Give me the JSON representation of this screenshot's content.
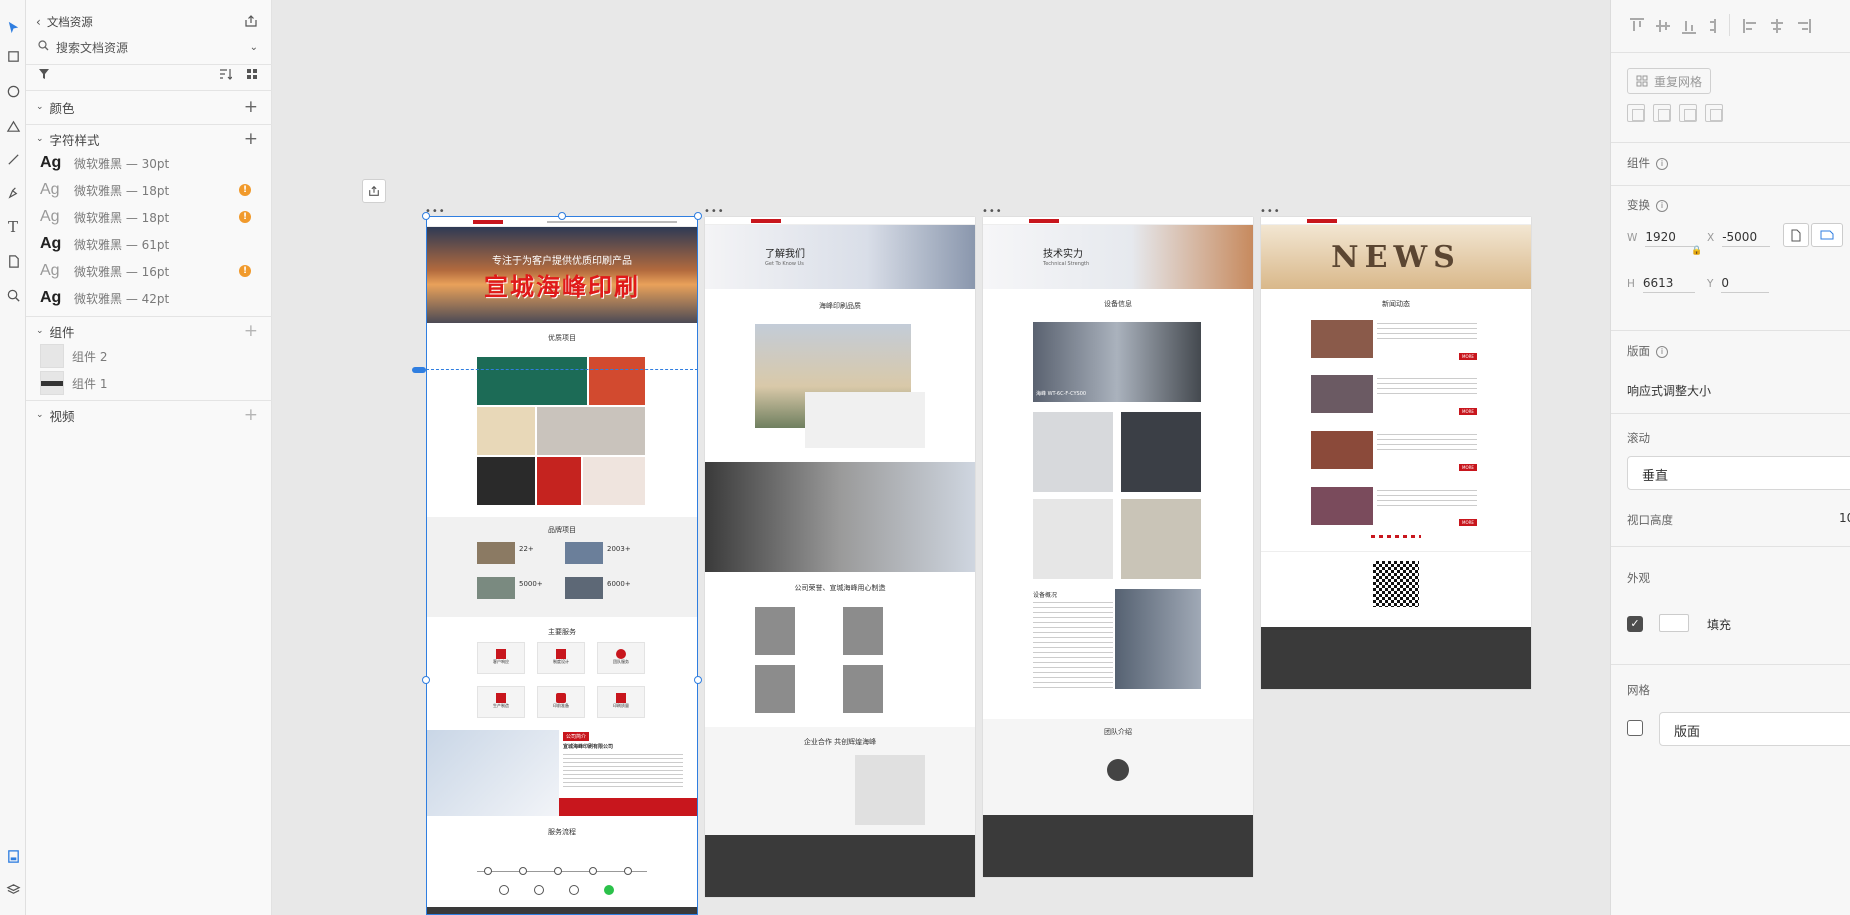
{
  "assets_panel": {
    "back_label": "文档资源",
    "search_placeholder": "搜索文档资源",
    "sections": {
      "colors": "颜色",
      "char_styles": "字符样式",
      "components": "组件",
      "video": "视频"
    },
    "char_styles": [
      {
        "sample": "Ag",
        "name": "微软雅黑 — 30pt",
        "weight": "bold",
        "warning": false
      },
      {
        "sample": "Ag",
        "name": "微软雅黑 — 18pt",
        "weight": "light",
        "warning": true
      },
      {
        "sample": "Ag",
        "name": "微软雅黑 — 18pt",
        "weight": "light",
        "warning": true
      },
      {
        "sample": "Ag",
        "name": "微软雅黑 — 61pt",
        "weight": "bold",
        "warning": false
      },
      {
        "sample": "Ag",
        "name": "微软雅黑 — 16pt",
        "weight": "light",
        "warning": true
      },
      {
        "sample": "Ag",
        "name": "微软雅黑 — 42pt",
        "weight": "bold",
        "warning": false
      }
    ],
    "components": [
      {
        "name": "组件 2",
        "thumb": "plain"
      },
      {
        "name": "组件 1",
        "thumb": "dark-bar"
      }
    ],
    "warning_glyph": "!"
  },
  "canvas": {
    "artboard_menu_glyph": "•••",
    "page1": {
      "hero_title": "宣城海峰印刷",
      "hero_sub": "专注于为客户提供优质印刷产品",
      "section1": "优质项目",
      "section2": "品牌项目",
      "section3": "主要服务",
      "section4": "服务流程",
      "stats": [
        "22+",
        "2003+",
        "5000+",
        "6000+"
      ],
      "service_tiles": [
        "客户响应",
        "制度设计",
        "团队服务",
        "生产制造",
        "印前准备",
        "印刷质量"
      ],
      "company_tag": "公司简介",
      "company_name": "宣城海峰印刷有限公司"
    },
    "page2": {
      "banner_title": "了解我们",
      "banner_sub": "Get To Know Us",
      "section1": "海峰印刷品质",
      "section2": "公司荣誉、宣城海峰用心制造",
      "section3": "企业合作 共创辉煌海峰"
    },
    "page3": {
      "banner_title": "技术实力",
      "banner_sub": "Technical Strength",
      "section1": "设备信息",
      "section2": "设备概况",
      "section3": "团队介绍",
      "machine_label": "海峰 WT-6C-F-CYS00"
    },
    "page4": {
      "banner_text": "NEWS",
      "section1": "新闻动态",
      "news_button": "MORE"
    }
  },
  "props_panel": {
    "repeat_grid_label": "重复网格",
    "component_label": "组件",
    "transform_label": "变换",
    "w_key": "W",
    "w_value": "1920",
    "h_key": "H",
    "h_value": "6613",
    "x_key": "X",
    "x_value": "-5000",
    "y_key": "Y",
    "y_value": "0",
    "layout_label": "版面",
    "responsive_label": "响应式调整大小",
    "scroll_label": "滚动",
    "scroll_value": "垂直",
    "viewport_label": "视口高度",
    "viewport_value": "10",
    "appearance_label": "外观",
    "fill_label": "填充",
    "grid_label": "网格",
    "grid_value": "版面"
  },
  "colors": {
    "accent_blue": "#2f7ee0",
    "brand_red": "#c8161d",
    "warning_orange": "#f19a2c",
    "footer_dark": "#3a3a3a"
  }
}
